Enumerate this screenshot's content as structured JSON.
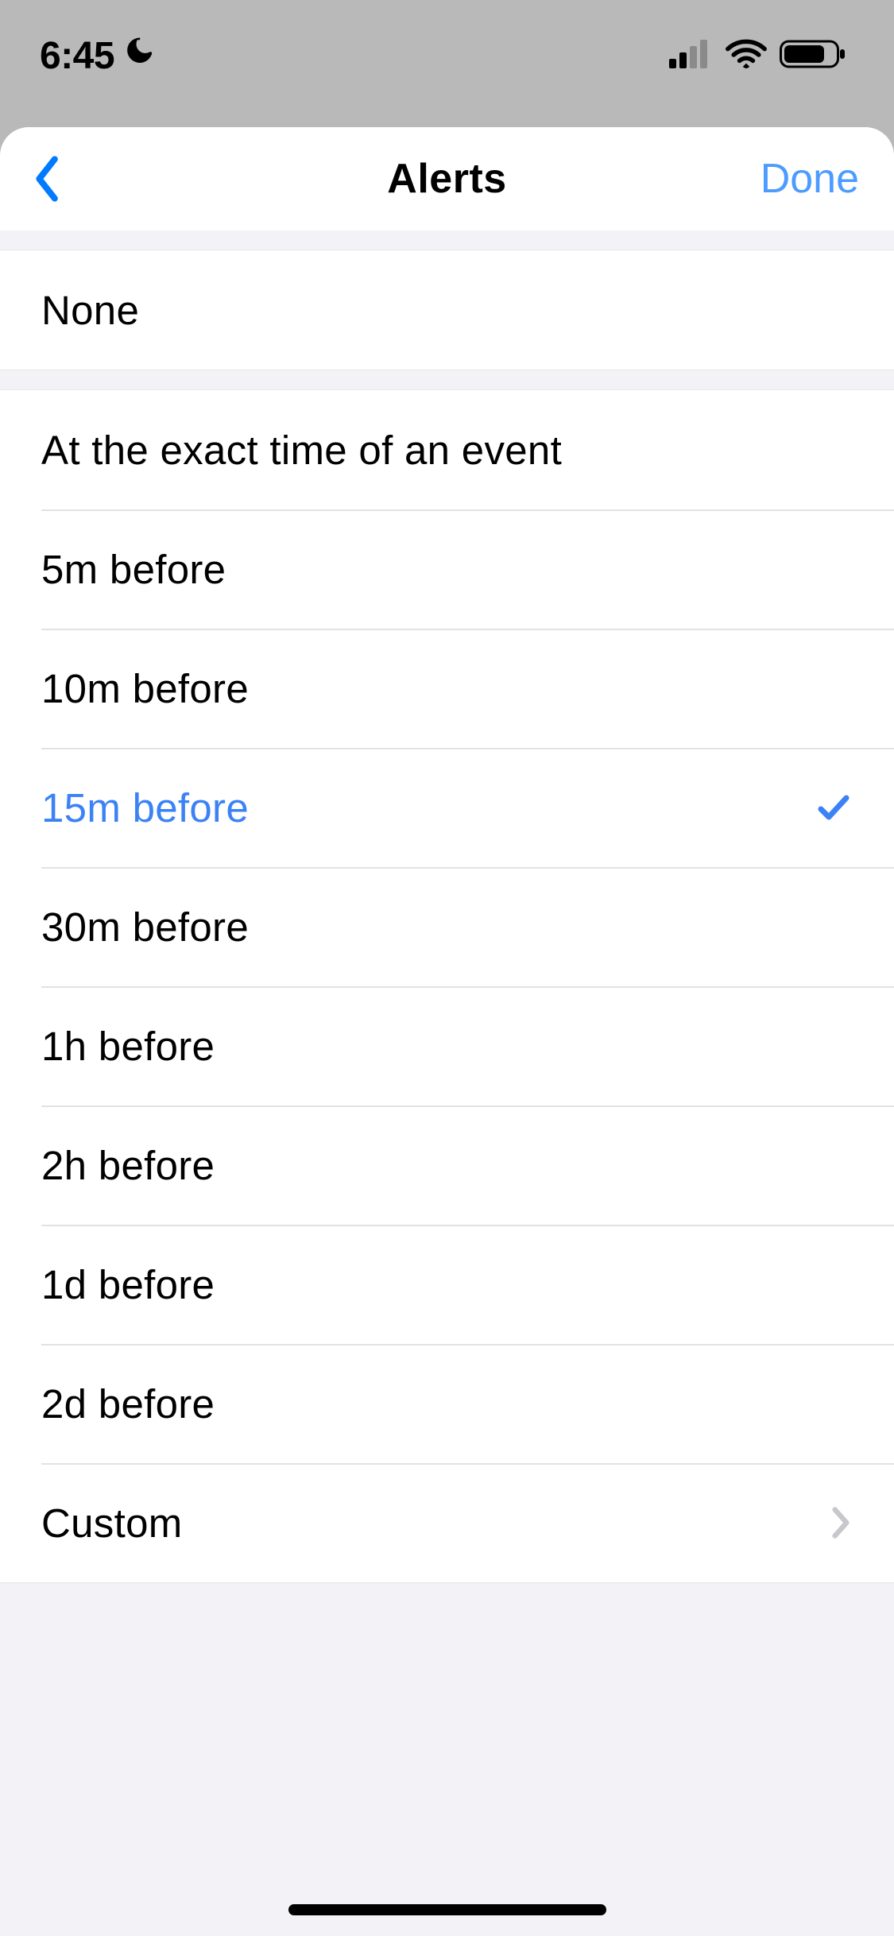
{
  "status": {
    "time": "6:45"
  },
  "navbar": {
    "title": "Alerts",
    "done": "Done"
  },
  "groups": {
    "none": {
      "label": "None"
    },
    "options": [
      {
        "id": "exact",
        "label": "At the exact time of an event",
        "selected": false,
        "disclosure": false
      },
      {
        "id": "5m",
        "label": "5m before",
        "selected": false,
        "disclosure": false
      },
      {
        "id": "10m",
        "label": "10m before",
        "selected": false,
        "disclosure": false
      },
      {
        "id": "15m",
        "label": "15m before",
        "selected": true,
        "disclosure": false
      },
      {
        "id": "30m",
        "label": "30m before",
        "selected": false,
        "disclosure": false
      },
      {
        "id": "1h",
        "label": "1h before",
        "selected": false,
        "disclosure": false
      },
      {
        "id": "2h",
        "label": "2h before",
        "selected": false,
        "disclosure": false
      },
      {
        "id": "1d",
        "label": "1d before",
        "selected": false,
        "disclosure": false
      },
      {
        "id": "2d",
        "label": "2d before",
        "selected": false,
        "disclosure": false
      },
      {
        "id": "custom",
        "label": "Custom",
        "selected": false,
        "disclosure": true
      }
    ]
  },
  "colors": {
    "accent": "#007aff",
    "selected": "#3b82f6"
  }
}
